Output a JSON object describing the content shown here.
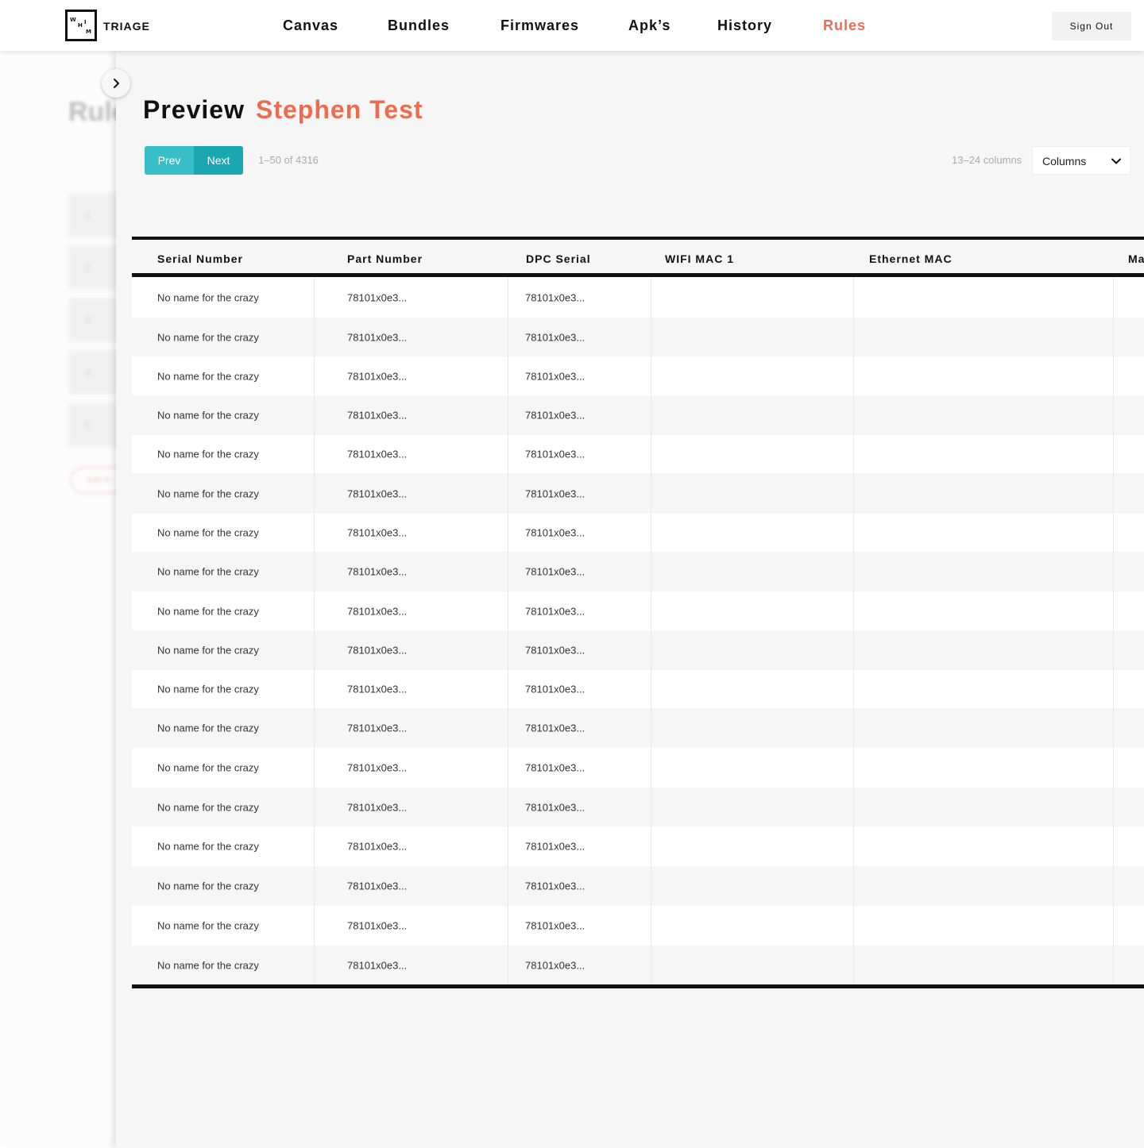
{
  "header": {
    "logo_letters": [
      "W",
      "H",
      "I",
      "M"
    ],
    "brand": "TRIAGE",
    "nav": [
      "Canvas",
      "Bundles",
      "Firmwares",
      "Apk’s",
      "History",
      "Rules"
    ],
    "active_nav": "Rules",
    "sign_out": "Sign Out"
  },
  "background": {
    "title": "Rule",
    "rows": [
      "1",
      "2",
      "3",
      "4",
      "5"
    ],
    "add_label": "Add R"
  },
  "panel": {
    "title": "Preview",
    "subtitle": "Stephen Test",
    "prev_label": "Prev",
    "next_label": "Next",
    "range_text": "1–50 of 4316",
    "column_count_text": "13–24 columns",
    "columns_select": "Columns"
  },
  "table": {
    "headers": [
      "Serial Number",
      "Part Number",
      "DPC Serial",
      "WIFI MAC 1",
      "Ethernet MAC",
      "Ma"
    ],
    "rows": [
      [
        "No name for the crazy",
        "78101x0e3...",
        "78101x0e3...",
        "",
        "",
        ""
      ],
      [
        "No name for the crazy",
        "78101x0e3...",
        "78101x0e3...",
        "",
        "",
        ""
      ],
      [
        "No name for the crazy",
        "78101x0e3...",
        "78101x0e3...",
        "",
        "",
        ""
      ],
      [
        "No name for the crazy",
        "78101x0e3...",
        "78101x0e3...",
        "",
        "",
        ""
      ],
      [
        "No name for the crazy",
        "78101x0e3...",
        "78101x0e3...",
        "",
        "",
        ""
      ],
      [
        "No name for the crazy",
        "78101x0e3...",
        "78101x0e3...",
        "",
        "",
        ""
      ],
      [
        "No name for the crazy",
        "78101x0e3...",
        "78101x0e3...",
        "",
        "",
        ""
      ],
      [
        "No name for the crazy",
        "78101x0e3...",
        "78101x0e3...",
        "",
        "",
        ""
      ],
      [
        "No name for the crazy",
        "78101x0e3...",
        "78101x0e3...",
        "",
        "",
        ""
      ],
      [
        "No name for the crazy",
        "78101x0e3...",
        "78101x0e3...",
        "",
        "",
        ""
      ],
      [
        "No name for the crazy",
        "78101x0e3...",
        "78101x0e3...",
        "",
        "",
        ""
      ],
      [
        "No name for the crazy",
        "78101x0e3...",
        "78101x0e3...",
        "",
        "",
        ""
      ],
      [
        "No name for the crazy",
        "78101x0e3...",
        "78101x0e3...",
        "",
        "",
        ""
      ],
      [
        "No name for the crazy",
        "78101x0e3...",
        "78101x0e3...",
        "",
        "",
        ""
      ],
      [
        "No name for the crazy",
        "78101x0e3...",
        "78101x0e3...",
        "",
        "",
        ""
      ],
      [
        "No name for the crazy",
        "78101x0e3...",
        "78101x0e3...",
        "",
        "",
        ""
      ],
      [
        "No name for the crazy",
        "78101x0e3...",
        "78101x0e3...",
        "",
        "",
        ""
      ],
      [
        "No name for the crazy",
        "78101x0e3...",
        "78101x0e3...",
        "",
        "",
        ""
      ]
    ]
  },
  "colors": {
    "accent": "#ee6c4d",
    "teal_light": "#38bec6",
    "teal_dark": "#1aa7b0"
  },
  "icons": {
    "expand": "chevron-right-icon",
    "dropdown": "chevron-down-icon"
  }
}
